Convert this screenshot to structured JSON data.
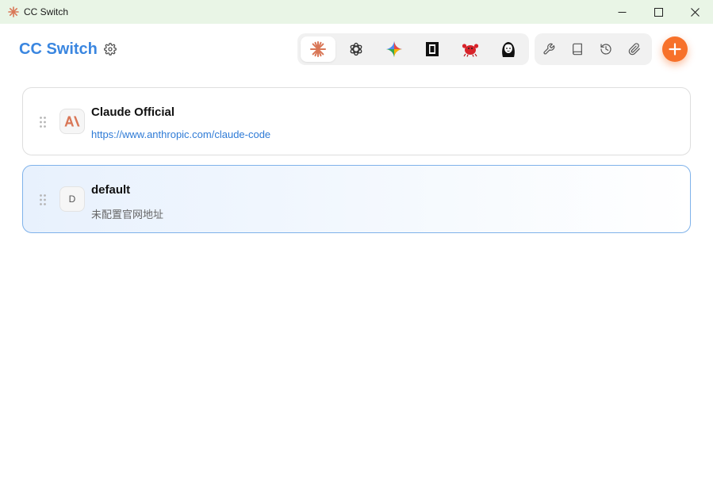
{
  "window": {
    "title": "CC Switch",
    "controls": [
      "minimize",
      "maximize",
      "close"
    ]
  },
  "header": {
    "brand": "CC Switch",
    "settings_icon": "gear-icon",
    "apps": [
      {
        "id": "claude",
        "icon": "claude-icon",
        "active": true
      },
      {
        "id": "codex",
        "icon": "openai-icon",
        "active": false
      },
      {
        "id": "gemini",
        "icon": "gemini-icon",
        "active": false
      },
      {
        "id": "opencode",
        "icon": "opencode-icon",
        "active": false
      },
      {
        "id": "crab",
        "icon": "crab-icon",
        "active": false
      },
      {
        "id": "avatar-app",
        "icon": "girl-avatar-icon",
        "active": false
      }
    ],
    "tools": [
      "wrench-icon",
      "book-icon",
      "history-icon",
      "attachment-icon"
    ],
    "add_icon": "plus-icon"
  },
  "colors": {
    "accent": "#3a86e0",
    "add_button": "#f7712a",
    "claude_orange": "#d97757",
    "active_border": "#7fb2ea",
    "titlebar": "#e9f5e6"
  },
  "providers": [
    {
      "name": "Claude Official",
      "url": "https://www.anthropic.com/claude-code",
      "avatar": "anthropic-logo",
      "active": false
    },
    {
      "name": "default",
      "url": "未配置官网地址",
      "avatar": "D",
      "active": true
    }
  ]
}
